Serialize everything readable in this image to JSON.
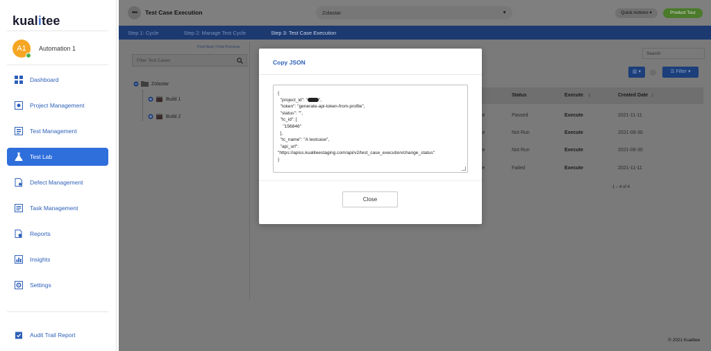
{
  "brand": {
    "logo_prefix": "kual",
    "logo_i": "i",
    "logo_suffix": "tee"
  },
  "user": {
    "initials": "A1",
    "name": "Automation 1"
  },
  "sidebar": {
    "items": [
      {
        "label": "Dashboard",
        "icon": "dashboard-icon"
      },
      {
        "label": "Project Management",
        "icon": "project-icon"
      },
      {
        "label": "Test Management",
        "icon": "test-management-icon"
      },
      {
        "label": "Test Lab",
        "icon": "flask-icon",
        "active": true
      },
      {
        "label": "Defect Management",
        "icon": "defect-icon"
      },
      {
        "label": "Task Management",
        "icon": "task-icon"
      },
      {
        "label": "Reports",
        "icon": "reports-icon"
      },
      {
        "label": "Insights",
        "icon": "insights-icon"
      },
      {
        "label": "Settings",
        "icon": "settings-icon"
      }
    ],
    "audit_label": "Audit Trail Report"
  },
  "header": {
    "title": "Test Case Execution",
    "project": "Zolastar",
    "quick_actions": "Quick Actions",
    "product_tour": "Product Tour"
  },
  "steps": [
    "Step 1: Cycle",
    "Step 2: Manage Test Cycle",
    "Step 3: Test Case Execution"
  ],
  "tree": {
    "find_next": "Find Next",
    "find_sep": "|",
    "find_previous": "Find Previous",
    "filter_placeholder": "Filter Test Cases",
    "root": "Zolastar",
    "builds": [
      "Build 1",
      "Build 2"
    ]
  },
  "table": {
    "search_placeholder": "Search",
    "filter_label": "Filter",
    "headers": {
      "status": "Status",
      "execute": "Execute",
      "created": "Created Date"
    },
    "rows": [
      {
        "cut": "le",
        "status": "Passed",
        "execute": "Execute",
        "created": "2021-11-11"
      },
      {
        "cut": "le",
        "status": "Not Run",
        "execute": "Execute",
        "created": "2021-09-30"
      },
      {
        "cut": "le",
        "status": "Not Run",
        "execute": "Execute",
        "created": "2021-09-30"
      },
      {
        "cut": "le",
        "status": "Failed",
        "execute": "Execute",
        "created": "2021-11-11"
      }
    ],
    "pager": "1 – 4 of 4"
  },
  "footer": "© 2021 Kualitee",
  "modal": {
    "title": "Copy JSON",
    "json_lines": {
      "l1": "{",
      "l2a": "  \"project_id\": \"",
      "l2b": "\",",
      "l3": "  \"token\": \"generate-api-token-from-profile\",",
      "l4": "  \"status\": \"\",",
      "l5": "  \"tc_id\": [",
      "l6": "    \"156846\"",
      "l7": "  ],",
      "l8": "  \"tc_name\": \"A testcase\",",
      "l9": "  \"api_url\":",
      "l10": "\"https://apiss.kualiteestaging.com/api/v2/test_case_execution/change_status\"",
      "l11": "}"
    },
    "close_label": "Close"
  },
  "colors": {
    "accent": "#2f6fdc",
    "nav_text": "#2d5fb8",
    "overlay": "#7a7a7a",
    "steps_bar": "#1d3a70",
    "product_tour": "#4a7a2a"
  }
}
